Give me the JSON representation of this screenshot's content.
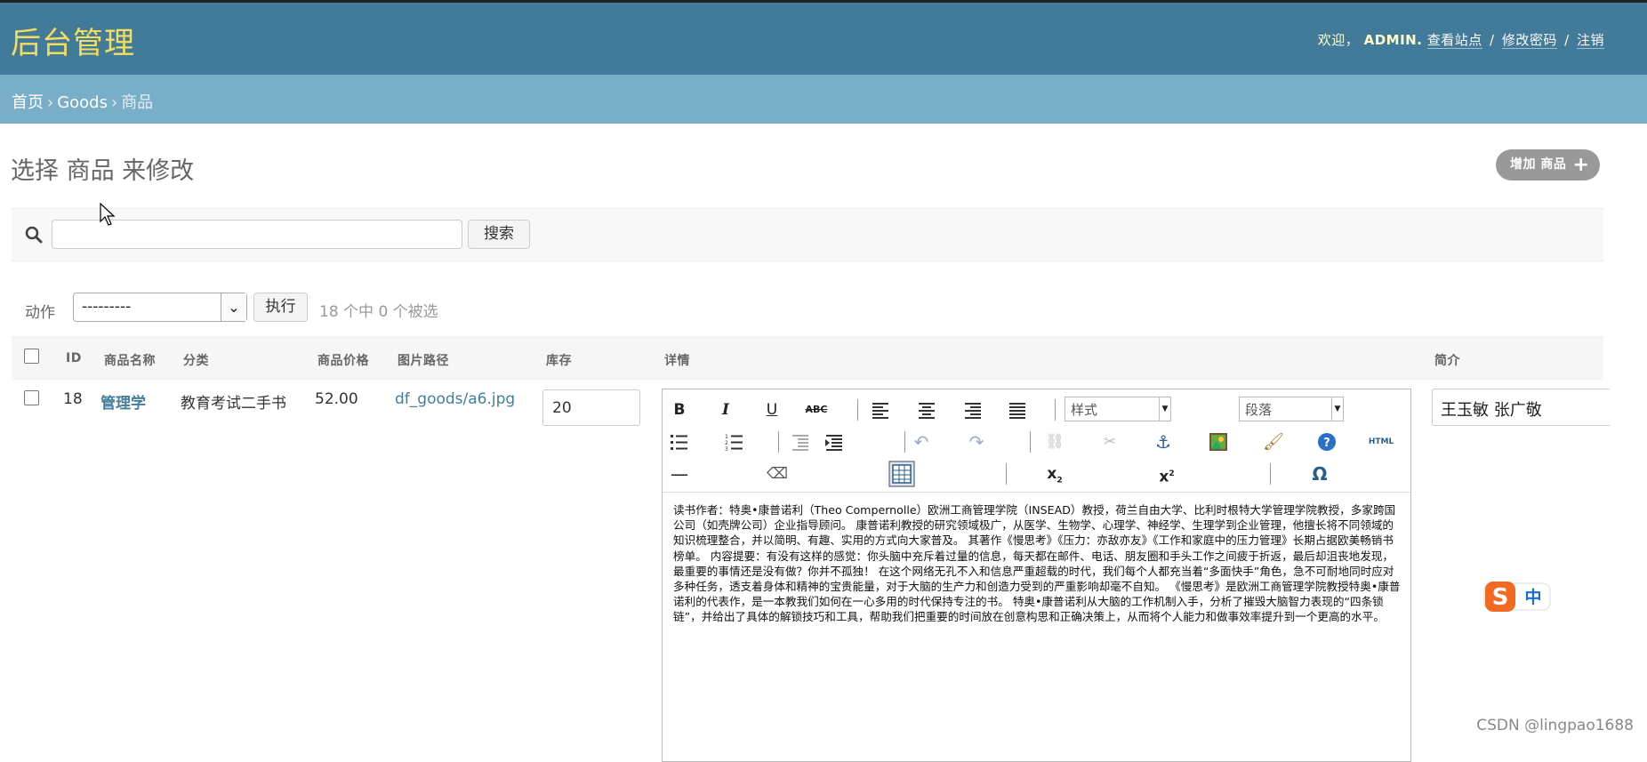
{
  "header": {
    "branding": "后台管理",
    "welcome": "欢迎，",
    "username": "ADMIN.",
    "links": [
      "查看站点",
      "修改密码",
      "注销"
    ]
  },
  "breadcrumbs": {
    "home": "首页",
    "app": "Goods",
    "current": "商品"
  },
  "page": {
    "title": "选择 商品 来修改",
    "add_button": "增加 商品"
  },
  "search": {
    "value": "",
    "button": "搜索"
  },
  "actions": {
    "label": "动作",
    "selected": "---------",
    "go_button": "执行",
    "counter": "18 个中 0 个被选"
  },
  "table": {
    "headers": [
      "ID",
      "商品名称",
      "分类",
      "商品价格",
      "图片路径",
      "库存",
      "详情",
      "简介"
    ],
    "rows": [
      {
        "id": "18",
        "name": "管理学",
        "category": "教育考试二手书",
        "price": "52.00",
        "image_path": "df_goods/a6.jpg",
        "stock": "20",
        "summary": "王玉敏 张广敬"
      }
    ]
  },
  "editor": {
    "style_select": "样式",
    "format_select": "段落",
    "html_label": "HTML",
    "content": "读书作者：特奥•康普诺利（Theo Compernolle）欧洲工商管理学院（INSEAD）教授，荷兰自由大学、比利时根特大学管理学院教授，多家跨国公司（如壳牌公司）企业指导顾问。 康普诺利教授的研究领域极广，从医学、生物学、心理学、神经学、生理学到企业管理，他擅长将不同领域的知识梳理整合，并以简明、有趣、实用的方式向大家普及。 其著作《慢思考》《压力：亦敌亦友》《工作和家庭中的压力管理》长期占据欧美畅销书榜单。 内容提要：有没有这样的感觉：你头脑中充斥着过量的信息，每天都在邮件、电话、朋友圈和手头工作之间疲于折返，最后却沮丧地发现，最重要的事情还是没有做？你并不孤独！ 在这个网络无孔不入和信息严重超载的时代，我们每个人都充当着“多面快手”角色，急不可耐地同时应对多种任务，透支着身体和精神的宝贵能量，对于大脑的生产力和创造力受到的严重影响却毫不自知。 《慢思考》是欧洲工商管理学院教授特奥•康普诺利的代表作，是一本教我们如何在一心多用的时代保持专注的书。 特奥•康普诺利从大脑的工作机制入手，分析了摧毁大脑智力表现的“四条锁链”，并给出了具体的解锁技巧和工具，帮助我们把重要的时间放在创意构思和正确决策上，从而将个人能力和做事效率提升到一个更高的水平。"
  },
  "ime": {
    "label": "中"
  },
  "watermark": "CSDN @lingpao1688",
  "colors": {
    "header_bg": "#427a9a",
    "branding": "#f5dd5d",
    "breadcrumb_bg": "#79aec8",
    "link": "#447e9b"
  }
}
